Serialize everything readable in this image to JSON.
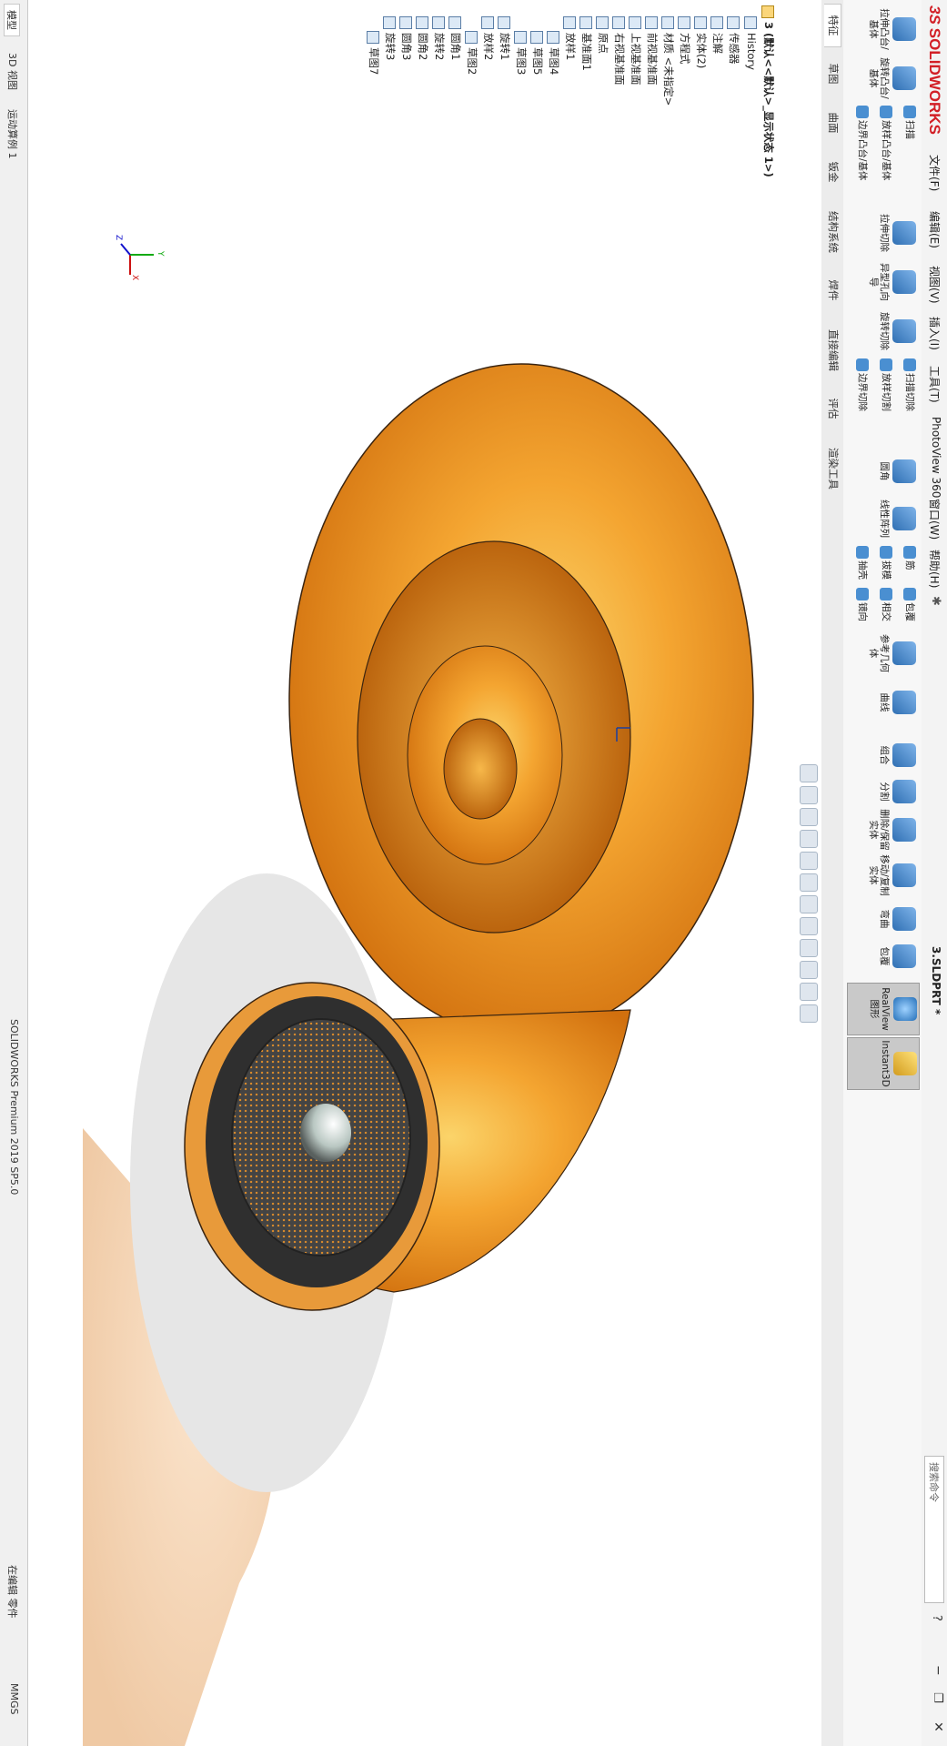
{
  "app": {
    "brand": "SOLIDWORKS",
    "menus": [
      "文件(F)",
      "编辑(E)",
      "视图(V)",
      "插入(I)",
      "工具(T)",
      "PhotoView 360",
      "窗口(W)",
      "帮助(H)"
    ],
    "doc_title": "3.SLDPRT *",
    "search_label": "搜索命令",
    "status_left": "SOLIDWORKS Premium 2019 SP5.0",
    "status_mid": "在编辑 零件",
    "status_units": "MMGS"
  },
  "ribbon": {
    "buttons": [
      {
        "label": "拉伸凸台/基体"
      },
      {
        "label": "旋转凸台/基体"
      },
      {
        "label": "扫描"
      },
      {
        "label": "放样凸台/基体"
      },
      {
        "label": "边界凸台/基体"
      },
      {
        "label": "拉伸切除"
      },
      {
        "label": "异型孔向导"
      },
      {
        "label": "旋转切除"
      },
      {
        "label": "扫描切除"
      },
      {
        "label": "放样切割"
      },
      {
        "label": "边界切除"
      },
      {
        "label": "圆角"
      },
      {
        "label": "线性阵列"
      },
      {
        "label": "筋"
      },
      {
        "label": "拔模"
      },
      {
        "label": "抽壳"
      },
      {
        "label": "包覆"
      },
      {
        "label": "相交"
      },
      {
        "label": "镜向"
      },
      {
        "label": "参考几何体"
      },
      {
        "label": "曲线"
      },
      {
        "label": "组合"
      },
      {
        "label": "分割"
      },
      {
        "label": "删除/保留实体"
      },
      {
        "label": "移动/复制实体"
      },
      {
        "label": "弯曲"
      },
      {
        "label": "包覆"
      }
    ],
    "toggles": [
      {
        "label": "RealView 图形"
      },
      {
        "label": "Instant3D"
      }
    ]
  },
  "tabs": [
    "特征",
    "草图",
    "曲面",
    "钣金",
    "结构系统",
    "焊件",
    "直接编辑",
    "评估",
    "渲染工具"
  ],
  "tree": {
    "header": "3 (默认<<默认>_显示状态 1>)",
    "items": [
      "History",
      "传感器",
      "注解",
      "实体(2)",
      "方程式",
      "材质 <未指定>",
      "前视基准面",
      "上视基准面",
      "右视基准面",
      "原点",
      "基准面1",
      "放样1",
      "草图4",
      "草图5",
      "草图3",
      "旋转1",
      "放样2",
      "草图2",
      "圆角1",
      "旋转2",
      "圆角2",
      "圆角3",
      "旋转3",
      "草图7"
    ]
  },
  "status_tabs": [
    "模型",
    "3D 视图",
    "运动算例 1"
  ],
  "colors": {
    "accent": "#2b6ba8",
    "shell_dark": "#e07d10",
    "shell_light": "#f9c15a",
    "speaker": "#3d3d3d"
  },
  "triad": {
    "x": "X",
    "y": "Y",
    "z": "Z"
  }
}
